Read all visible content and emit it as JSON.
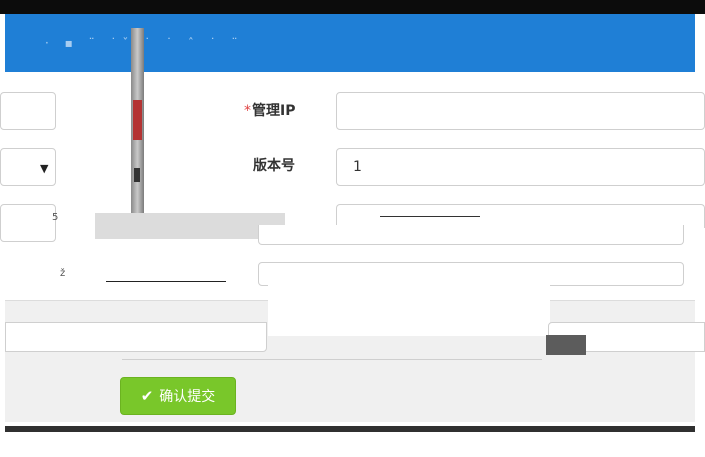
{
  "form": {
    "mgmt_ip": {
      "label": "管理IP",
      "value": ""
    },
    "version": {
      "label": "版本号",
      "value": "1"
    }
  },
  "actions": {
    "submit_label": "确认提交"
  }
}
